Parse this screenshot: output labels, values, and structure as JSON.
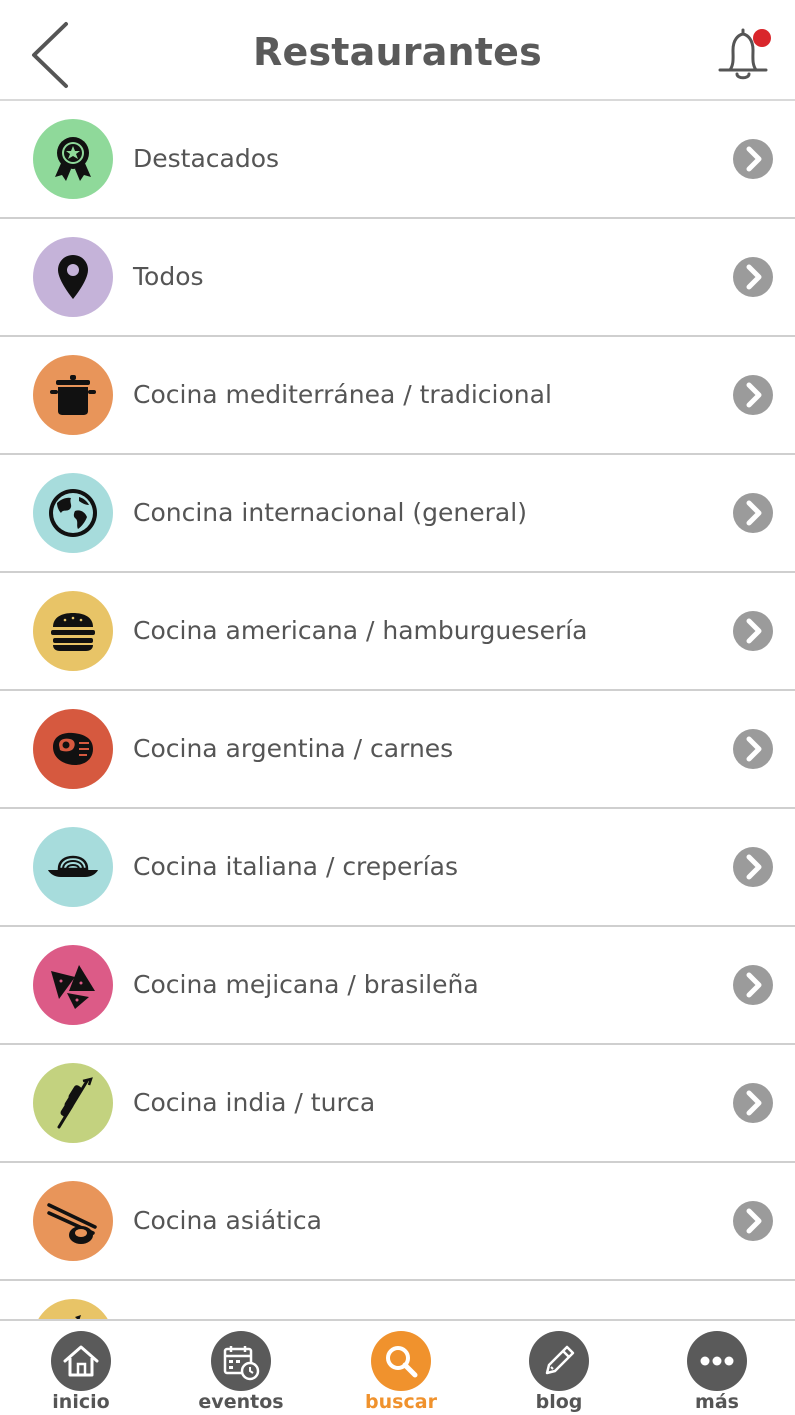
{
  "header": {
    "title": "Restaurantes"
  },
  "colors": {
    "accent": "#f0922d",
    "notification_dot": "#d9262b",
    "chevron": "#9b9b9b",
    "tab_icon_bg": "#5a5a5a"
  },
  "categories": [
    {
      "label": "Destacados",
      "icon": "award-ribbon-icon",
      "color": "#8fd99a"
    },
    {
      "label": "Todos",
      "icon": "map-pin-icon",
      "color": "#c5b3d9"
    },
    {
      "label": "Cocina mediterránea / tradicional",
      "icon": "cooking-pot-icon",
      "color": "#e8955a"
    },
    {
      "label": "Concina internacional (general)",
      "icon": "globe-icon",
      "color": "#a7dcdc"
    },
    {
      "label": "Cocina americana / hamburguesería",
      "icon": "hamburger-icon",
      "color": "#e8c467"
    },
    {
      "label": "Cocina argentina / carnes",
      "icon": "steak-icon",
      "color": "#d6593f"
    },
    {
      "label": "Cocina italiana / creperías",
      "icon": "pasta-plate-icon",
      "color": "#a7dcdc"
    },
    {
      "label": "Cocina mejicana / brasileña",
      "icon": "nachos-icon",
      "color": "#dc5b87"
    },
    {
      "label": "Cocina india / turca",
      "icon": "kebab-skewer-icon",
      "color": "#c3d27f"
    },
    {
      "label": "Cocina asiática",
      "icon": "sushi-chopsticks-icon",
      "color": "#e8955a"
    },
    {
      "label": "",
      "icon": "partial-category-icon",
      "color": "#e8c467"
    }
  ],
  "tabbar": {
    "items": [
      {
        "label": "inicio",
        "icon": "home-icon",
        "active": false
      },
      {
        "label": "eventos",
        "icon": "calendar-clock-icon",
        "active": false
      },
      {
        "label": "buscar",
        "icon": "search-icon",
        "active": true
      },
      {
        "label": "blog",
        "icon": "pencil-icon",
        "active": false
      },
      {
        "label": "más",
        "icon": "more-dots-icon",
        "active": false
      }
    ]
  }
}
